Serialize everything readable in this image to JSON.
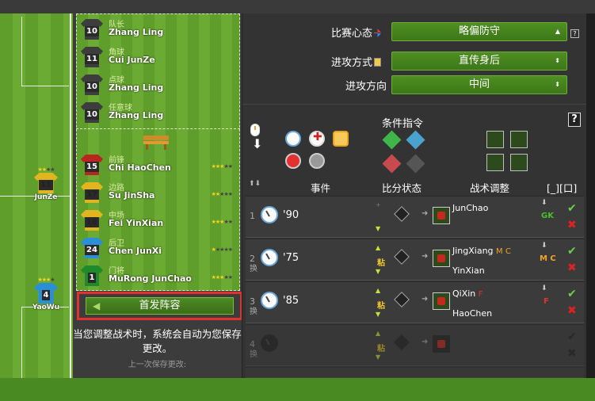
{
  "pitch_players": [
    {
      "number": "11",
      "name": "JunZe",
      "stars": 2
    },
    {
      "number": "4",
      "name": "YaoWu",
      "stars": 3
    }
  ],
  "roles": [
    {
      "role": "队长",
      "number": "10",
      "name": "Zhang Ling"
    },
    {
      "role": "角球",
      "number": "11",
      "name": "Cui JunZe"
    },
    {
      "role": "点球",
      "number": "10",
      "name": "Zhang Ling"
    },
    {
      "role": "任意球",
      "number": "10",
      "name": "Zhang Ling"
    }
  ],
  "bench": [
    {
      "position": "前锋",
      "number": "15",
      "name": "Chi HaoChen",
      "stars": 3,
      "color": "#b8261f"
    },
    {
      "position": "边路",
      "number": "17",
      "name": "Su JinSha",
      "stars": 2,
      "color": "#e0b51f"
    },
    {
      "position": "中场",
      "number": "16",
      "name": "Fei YinXian",
      "stars": 3,
      "color": "#e0b51f"
    },
    {
      "position": "后卫",
      "number": "24",
      "name": "Chen JunXi",
      "stars": 1,
      "color": "#2a8fd6"
    },
    {
      "position": "门将",
      "number": "1",
      "name": "MuRong JunChao",
      "stars": 3,
      "color": "#1f8a2a"
    }
  ],
  "lineup_button": "首发阵容",
  "notice": "当您调整战术时，系统会自动为您保存更改。",
  "last_save": "上一次保存更改:",
  "tactics": {
    "mentality_label": "比赛心态",
    "mentality_value": "略偏防守",
    "attack_style_label": "进攻方式",
    "attack_style_value": "直传身后",
    "attack_dir_label": "进攻方向",
    "attack_dir_value": "中间"
  },
  "conditions_title": "条件指令",
  "table_headers": {
    "event": "事件",
    "score_state": "比分状态",
    "adjust": "战术调整",
    "cols": "[_][口]"
  },
  "events": [
    {
      "index": "1",
      "minute": "'90",
      "player_in": "JunChao",
      "player_out": "",
      "pos_in": "GK",
      "pos_in_color": "#4bbf2a",
      "sticky": false
    },
    {
      "index": "2",
      "minute": "'75",
      "player_in": "JingXiang",
      "pos_in_tags": "M C",
      "player_out": "YinXian",
      "pos_out_tags": "M C",
      "sticky": true
    },
    {
      "index": "3",
      "minute": "'85",
      "player_in": "QiXin",
      "pos_in_tags": "F",
      "player_out": "HaoChen",
      "pos_out_tags": "F",
      "sticky": true
    },
    {
      "index": "4",
      "minute": "",
      "player_in": "",
      "player_out": "",
      "sticky": true
    }
  ],
  "sticky_label": "粘",
  "swap_label": "换",
  "colors": {
    "grass_dark": "#5f9e2b",
    "grass_light": "#6cab33",
    "panel": "#333333",
    "select_green": "#4e8f22",
    "highlight_red": "#e53030",
    "star": "#f7d21b"
  }
}
